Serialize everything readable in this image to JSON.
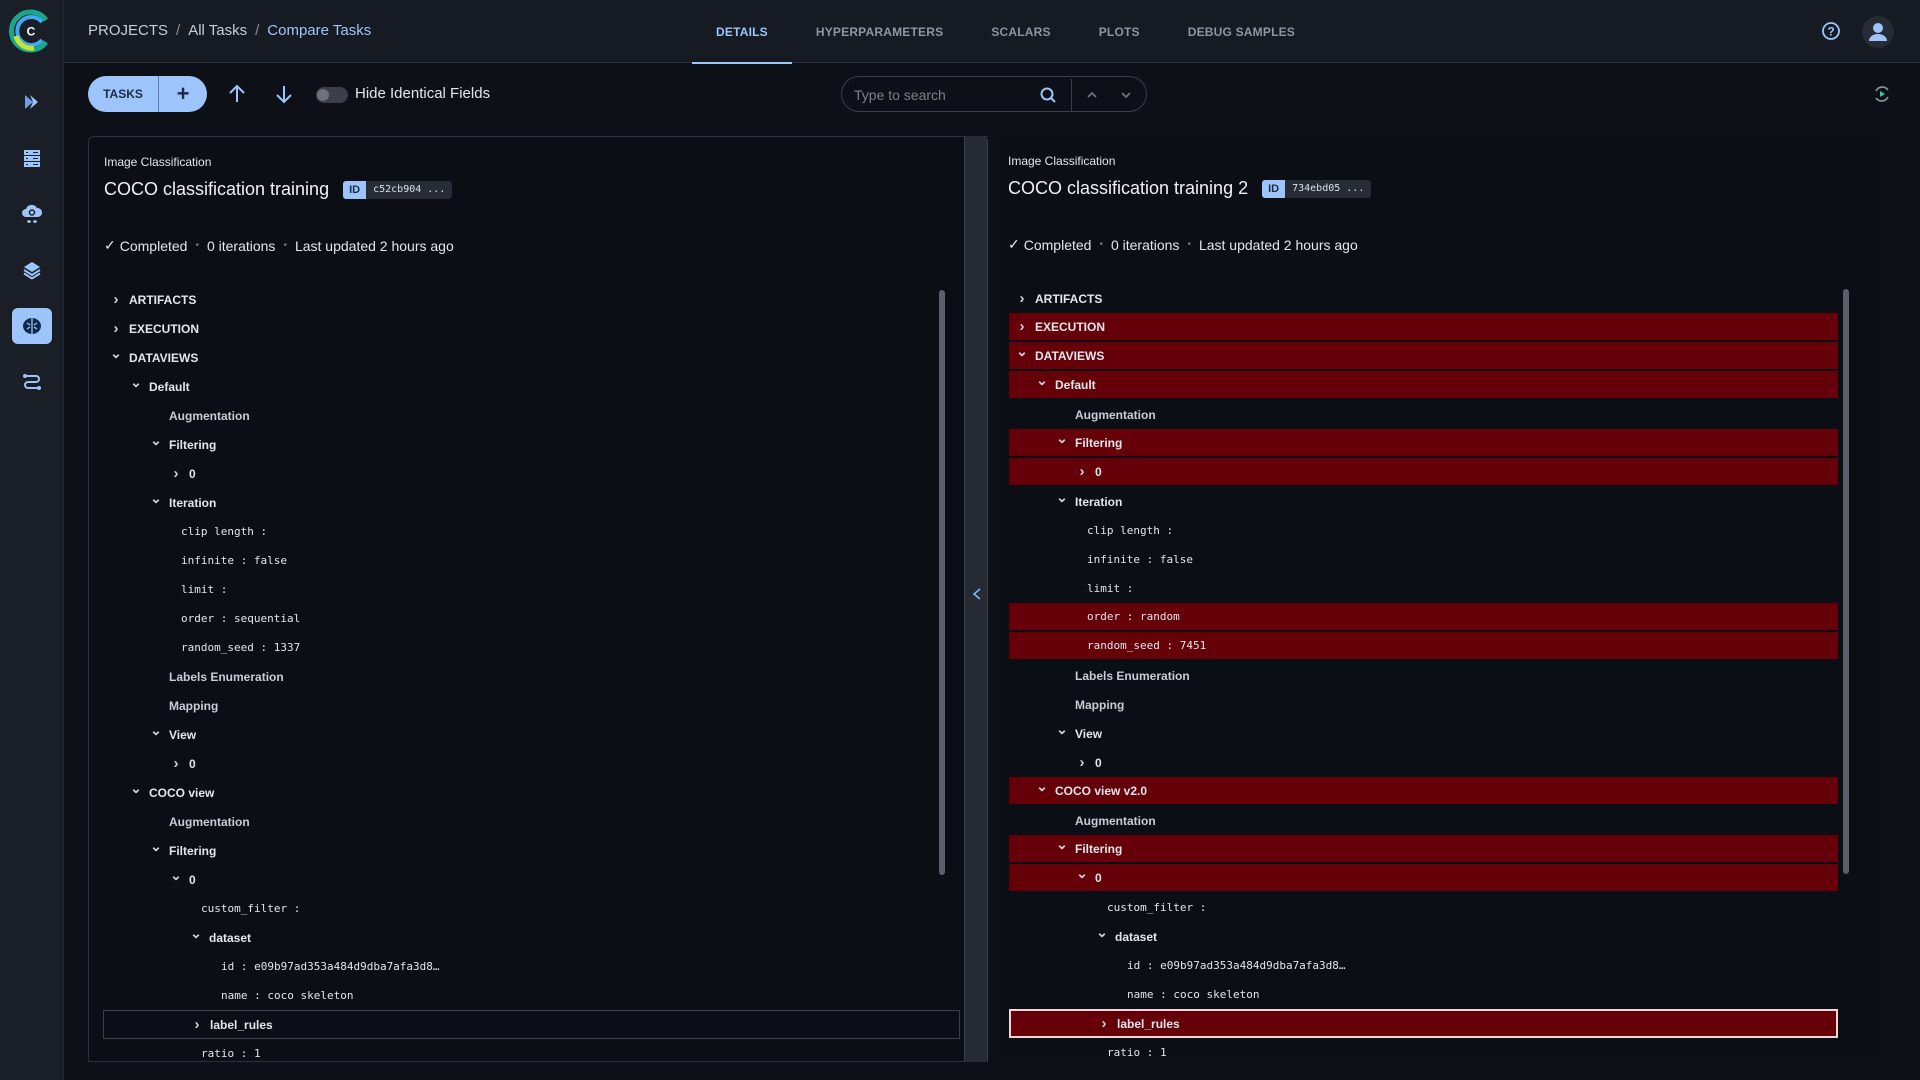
{
  "app": {
    "logo_letter": "C"
  },
  "sidebar": {
    "items": [
      {
        "name": "pipelines",
        "icon": "chevron-double-right-icon"
      },
      {
        "name": "datasets",
        "icon": "server-rack-icon"
      },
      {
        "name": "orchestration",
        "icon": "cloud-gear-icon"
      },
      {
        "name": "models",
        "icon": "layers-icon"
      },
      {
        "name": "experiments",
        "icon": "brain-icon",
        "active": true
      },
      {
        "name": "reports",
        "icon": "workflow-icon"
      }
    ]
  },
  "header": {
    "breadcrumb": [
      "PROJECTS",
      "All Tasks",
      "Compare Tasks"
    ],
    "tabs": [
      "DETAILS",
      "HYPERPARAMETERS",
      "SCALARS",
      "PLOTS",
      "DEBUG SAMPLES"
    ],
    "active_tab": "DETAILS"
  },
  "toolbar": {
    "tasks_label": "TASKS",
    "add_label": "+",
    "hide_identical_label": "Hide Identical Fields",
    "hide_identical_on": false,
    "search_placeholder": "Type to search",
    "search_value": ""
  },
  "colors": {
    "accent": "#9ec5fb",
    "diff": "#650008",
    "background": "#0b0e14"
  },
  "tasks": [
    {
      "type": "Image Classification",
      "name": "COCO classification training",
      "id_label": "ID",
      "id": "c52cb904 ...",
      "status": "Completed",
      "iterations": "0 iterations",
      "updated": "Last updated 2 hours ago",
      "tree": [
        {
          "label": "ARTIFACTS",
          "indent": 0,
          "chev": "right"
        },
        {
          "label": "EXECUTION",
          "indent": 0,
          "chev": "right"
        },
        {
          "label": "DATAVIEWS",
          "indent": 0,
          "chev": "down"
        },
        {
          "label": "Default",
          "indent": 1,
          "chev": "down"
        },
        {
          "label": "Augmentation",
          "indent": 2,
          "chev": "none",
          "muted": true
        },
        {
          "label": "Filtering",
          "indent": 2,
          "chev": "down"
        },
        {
          "label": "0",
          "indent": 3,
          "chev": "right"
        },
        {
          "label": "Iteration",
          "indent": 2,
          "chev": "down"
        },
        {
          "label": "clip length :",
          "indent": 3,
          "kv": true
        },
        {
          "label": "infinite : false",
          "indent": 3,
          "kv": true
        },
        {
          "label": "limit :",
          "indent": 3,
          "kv": true
        },
        {
          "label": "order : sequential",
          "indent": 3,
          "kv": true
        },
        {
          "label": "random_seed : 1337",
          "indent": 3,
          "kv": true
        },
        {
          "label": "Labels Enumeration",
          "indent": 2,
          "chev": "none",
          "muted": true
        },
        {
          "label": "Mapping",
          "indent": 2,
          "chev": "none",
          "muted": true
        },
        {
          "label": "View",
          "indent": 2,
          "chev": "down"
        },
        {
          "label": "0",
          "indent": 3,
          "chev": "right"
        },
        {
          "label": "COCO view",
          "indent": 1,
          "chev": "down"
        },
        {
          "label": "Augmentation",
          "indent": 2,
          "chev": "none",
          "muted": true
        },
        {
          "label": "Filtering",
          "indent": 2,
          "chev": "down"
        },
        {
          "label": "0",
          "indent": 3,
          "chev": "down"
        },
        {
          "label": "custom_filter :",
          "indent": 4,
          "kv": true
        },
        {
          "label": "dataset",
          "indent": 4,
          "chev": "down"
        },
        {
          "label": "id : e09b97ad353a484d9dba7afa3d8…",
          "indent": 5,
          "kv": true
        },
        {
          "label": "name : coco skeleton",
          "indent": 5,
          "kv": true
        },
        {
          "label": "label_rules",
          "indent": 4,
          "chev": "right",
          "selected": true
        },
        {
          "label": "ratio : 1",
          "indent": 4,
          "kv": true
        }
      ]
    },
    {
      "type": "Image Classification",
      "name": "COCO classification training 2",
      "id_label": "ID",
      "id": "734ebd05 ...",
      "status": "Completed",
      "iterations": "0 iterations",
      "updated": "Last updated 2 hours ago",
      "tree": [
        {
          "label": "ARTIFACTS",
          "indent": 0,
          "chev": "right"
        },
        {
          "label": "EXECUTION",
          "indent": 0,
          "chev": "right",
          "diff": true
        },
        {
          "label": "DATAVIEWS",
          "indent": 0,
          "chev": "down",
          "diff": true
        },
        {
          "label": "Default",
          "indent": 1,
          "chev": "down",
          "diff": true
        },
        {
          "label": "Augmentation",
          "indent": 2,
          "chev": "none",
          "muted": true
        },
        {
          "label": "Filtering",
          "indent": 2,
          "chev": "down",
          "diff": true
        },
        {
          "label": "0",
          "indent": 3,
          "chev": "right",
          "diff": true
        },
        {
          "label": "Iteration",
          "indent": 2,
          "chev": "down"
        },
        {
          "label": "clip length :",
          "indent": 3,
          "kv": true
        },
        {
          "label": "infinite : false",
          "indent": 3,
          "kv": true
        },
        {
          "label": "limit :",
          "indent": 3,
          "kv": true
        },
        {
          "label": "order : random",
          "indent": 3,
          "kv": true,
          "diff": true
        },
        {
          "label": "random_seed : 7451",
          "indent": 3,
          "kv": true,
          "diff": true
        },
        {
          "label": "Labels Enumeration",
          "indent": 2,
          "chev": "none",
          "muted": true
        },
        {
          "label": "Mapping",
          "indent": 2,
          "chev": "none",
          "muted": true
        },
        {
          "label": "View",
          "indent": 2,
          "chev": "down"
        },
        {
          "label": "0",
          "indent": 3,
          "chev": "right"
        },
        {
          "label": "COCO view v2.0",
          "indent": 1,
          "chev": "down",
          "diff": true
        },
        {
          "label": "Augmentation",
          "indent": 2,
          "chev": "none",
          "muted": true
        },
        {
          "label": "Filtering",
          "indent": 2,
          "chev": "down",
          "diff": true
        },
        {
          "label": "0",
          "indent": 3,
          "chev": "down",
          "diff": true
        },
        {
          "label": "custom_filter :",
          "indent": 4,
          "kv": true
        },
        {
          "label": "dataset",
          "indent": 4,
          "chev": "down"
        },
        {
          "label": "id : e09b97ad353a484d9dba7afa3d8…",
          "indent": 5,
          "kv": true
        },
        {
          "label": "name : coco skeleton",
          "indent": 5,
          "kv": true
        },
        {
          "label": "label_rules",
          "indent": 4,
          "chev": "right",
          "selected": true,
          "diff": true
        },
        {
          "label": "ratio : 1",
          "indent": 4,
          "kv": true
        }
      ]
    }
  ]
}
